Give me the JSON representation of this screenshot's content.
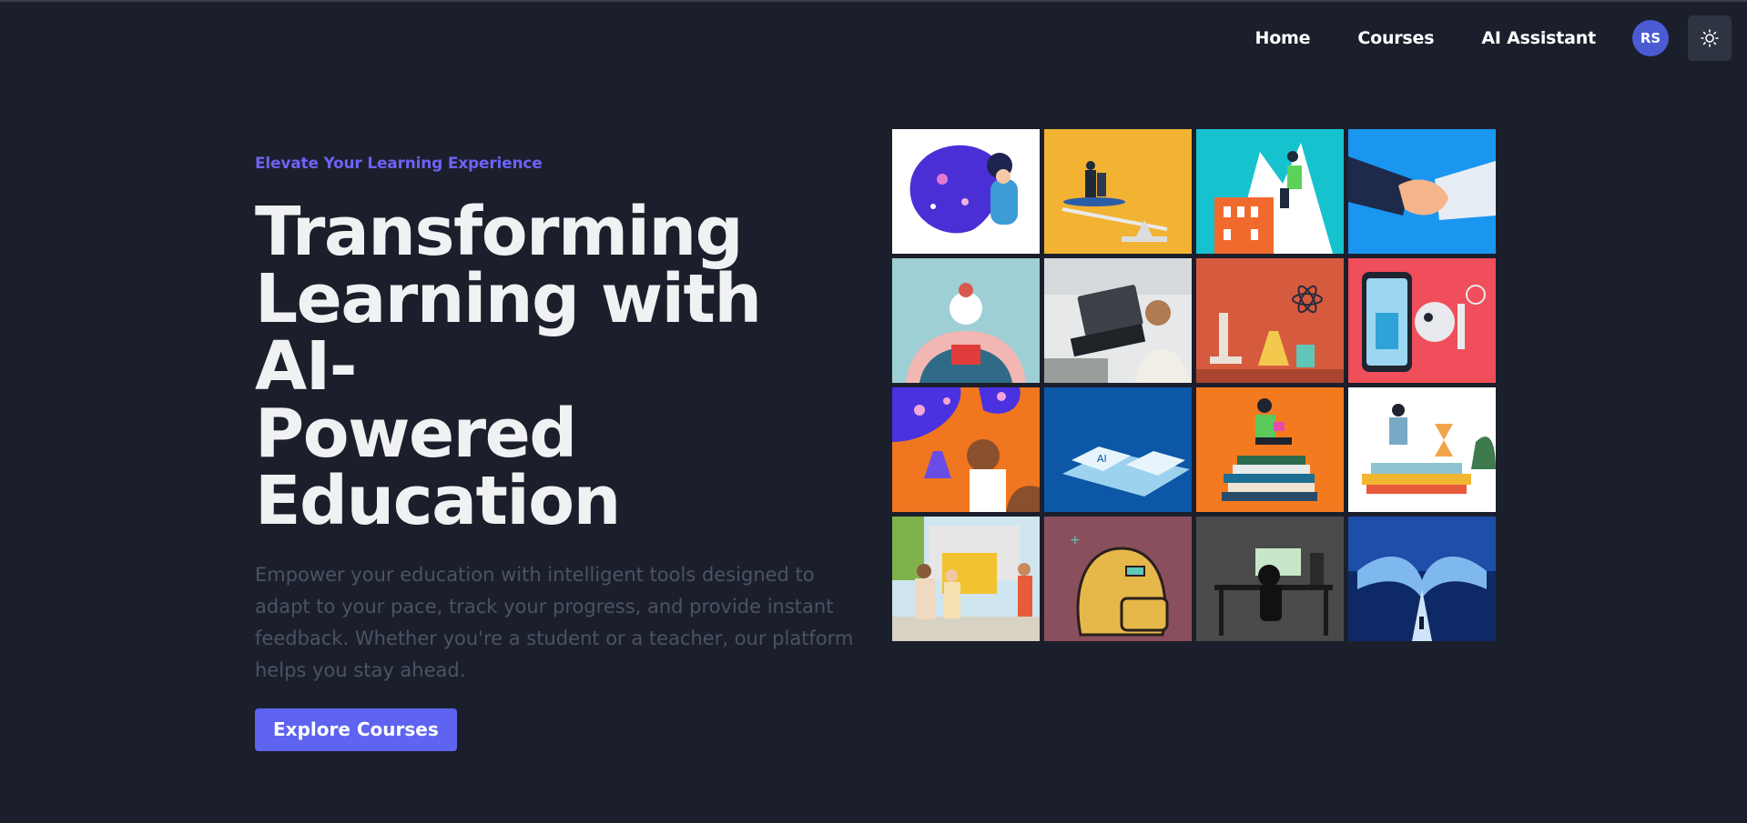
{
  "nav": {
    "home": "Home",
    "courses": "Courses",
    "assistant": "AI Assistant",
    "avatar_initials": "RS",
    "theme_icon": "sun-icon"
  },
  "hero": {
    "eyebrow": "Elevate Your Learning Experience",
    "title_line1": "Transforming",
    "title_line2": "Learning with AI-",
    "title_line3": "Powered Education",
    "description": "Empower your education with intelligent tools designed to adapt to your pace, track your progress, and provide instant feedback. Whether you're a student or a teacher, our platform helps you stay ahead.",
    "cta_label": "Explore Courses"
  },
  "colors": {
    "background": "#1b1f2b",
    "accent": "#6c63f4",
    "button": "#5e64ef",
    "avatar": "#4a5bd4"
  },
  "gallery": {
    "tiles": [
      "space-reader-illustration",
      "balance-seesaw-illustration",
      "mountain-climber-illustration",
      "handshake-robot-illustration",
      "girl-reading-illustration",
      "laptop-student-illustration",
      "science-lab-illustration",
      "phone-robot-illustration",
      "chemistry-student-illustration",
      "ai-keyboard-illustration",
      "book-stack-reader-illustration",
      "study-desk-illustration",
      "school-students-illustration",
      "backpack-illustration",
      "computer-desk-illustration",
      "open-book-path-illustration"
    ]
  }
}
